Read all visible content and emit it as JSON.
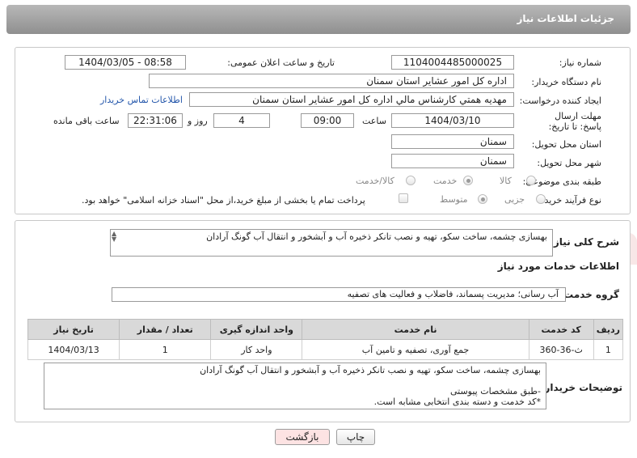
{
  "header": {
    "title": "جزئیات اطلاعات نیاز"
  },
  "form": {
    "need_number_label": "شماره نیاز:",
    "need_number": "1104004485000025",
    "announce_label": "تاریخ و ساعت اعلان عمومی:",
    "announce_value": "1404/03/05 - 08:58",
    "buyer_org_label": "نام دستگاه خریدار:",
    "buyer_org": "اداره کل امور عشایر استان سمنان",
    "creator_label": "ایجاد کننده درخواست:",
    "creator": "مهدیه همتي کارشناس مالي اداره کل امور عشاير استان سمنان",
    "contact_link": "اطلاعات تماس خریدار",
    "deadline_label": "مهلت ارسال پاسخ: تا تاریخ:",
    "deadline_date": "1404/03/10",
    "time_label": "ساعت",
    "deadline_time": "09:00",
    "days_value": "4",
    "days_label": "روز و",
    "remaining_time": "22:31:06",
    "remaining_label": "ساعت باقی مانده",
    "province_label": "استان محل تحویل:",
    "province": "سمنان",
    "city_label": "شهر محل تحویل:",
    "city": "سمنان",
    "category_label": "طبقه بندی موضوعی:",
    "category_options": [
      "کالا",
      "خدمت",
      "کالا/خدمت"
    ],
    "category_selected": "خدمت",
    "process_label": "نوع فرآیند خرید :",
    "process_options": [
      "جزیی",
      "متوسط"
    ],
    "process_selected": "متوسط",
    "payment_text": "پرداخت تمام یا بخشی از مبلغ خرید،از محل \"اسناد خزانه اسلامی\" خواهد بود."
  },
  "summary": {
    "label": "شرح کلی نیاز:",
    "text": "بهسازی چشمه، ساخت سکو، تهیه و نصب تانکر ذخیره آب و آبشخور و انتقال آب گونگ آرادان"
  },
  "services": {
    "section_title": "اطلاعات خدمات مورد نیاز",
    "group_label": "گروه خدمت:",
    "group_value": "آب رسانی؛ مدیریت پسماند، فاضلاب و فعالیت های تصفیه",
    "columns": [
      "ردیف",
      "کد خدمت",
      "نام خدمت",
      "واحد اندازه گیری",
      "تعداد / مقدار",
      "تاریخ نیاز"
    ],
    "rows": [
      {
        "row": "1",
        "code": "ث-36-360",
        "name": "جمع آوری، تصفیه و تامین آب",
        "unit": "واحد کار",
        "qty": "1",
        "date": "1404/03/13"
      }
    ]
  },
  "buyer_notes": {
    "label": "توضیحات خریدار:",
    "text": "بهسازی چشمه، ساخت سکو، تهیه و نصب تانکر ذخیره آب و آبشخور و انتقال آب گونگ آرادان\n\n-طبق مشخصات پیوستی\n*کد خدمت و دسته بندی انتخابی مشابه است."
  },
  "buttons": {
    "print": "چاپ",
    "back": "بازگشت"
  },
  "colors": {
    "header": "#a0a0a0",
    "link": "#2255aa",
    "back_button_bg": "#fde3e3"
  }
}
